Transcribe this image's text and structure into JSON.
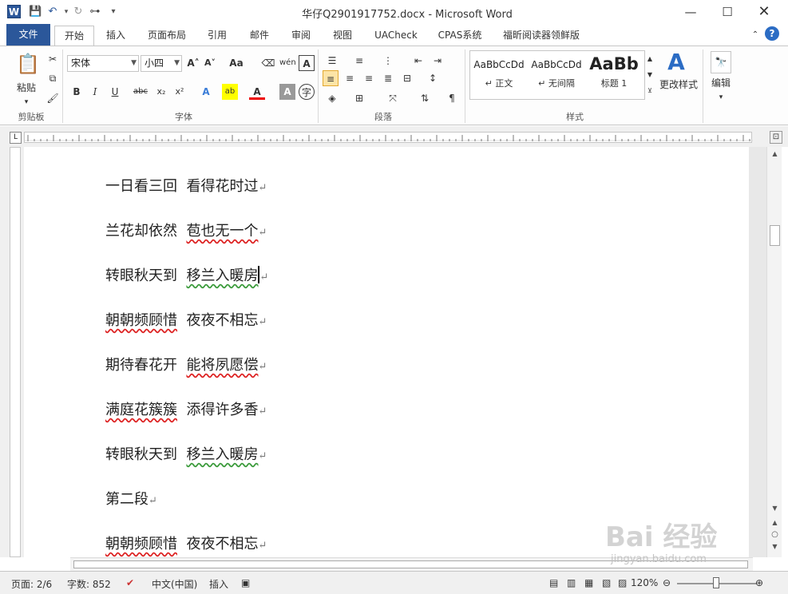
{
  "window": {
    "title": "华仔Q2901917752.docx - Microsoft Word",
    "app_icon": "W"
  },
  "tabs": [
    "文件",
    "开始",
    "插入",
    "页面布局",
    "引用",
    "邮件",
    "审阅",
    "视图",
    "UACheck",
    "CPAS系统",
    "福昕阅读器领鲜版"
  ],
  "ribbon": {
    "clipboard": {
      "paste": "粘贴",
      "label": "剪贴板"
    },
    "font": {
      "name": "宋体",
      "size": "小四",
      "label": "字体"
    },
    "paragraph": {
      "label": "段落"
    },
    "styles": {
      "label": "样式",
      "items": [
        {
          "preview": "AaBbCcDd",
          "name": "↵ 正文"
        },
        {
          "preview": "AaBbCcDd",
          "name": "↵ 无间隔"
        },
        {
          "preview": "AaBb",
          "name": "标题 1"
        }
      ],
      "change": "更改样式"
    },
    "edit": {
      "label": "编辑"
    }
  },
  "document": {
    "lines": [
      {
        "a": "一日看三回",
        "b": "看得花时过"
      },
      {
        "a": "兰花却依然",
        "b": "苞也无一个"
      },
      {
        "a": "转眼秋天到",
        "b": "移兰入暖房"
      },
      {
        "a": "朝朝频顾惜",
        "b": "夜夜不相忘"
      },
      {
        "a": "期待春花开",
        "b": "能将夙愿偿"
      },
      {
        "a": "满庭花簇簇",
        "b": "添得许多香"
      },
      {
        "a": "转眼秋天到",
        "b": "移兰入暖房"
      },
      {
        "a": "第二段",
        "b": ""
      },
      {
        "a": "朝朝频顾惜",
        "b": "夜夜不相忘"
      }
    ],
    "para_mark": "↵"
  },
  "status": {
    "page": "页面: 2/6",
    "words": "字数: 852",
    "lang": "中文(中国)",
    "mode": "插入",
    "zoom": "120%"
  },
  "watermark": {
    "main": "Bai 经验",
    "sub": "jingyan.baidu.com"
  }
}
